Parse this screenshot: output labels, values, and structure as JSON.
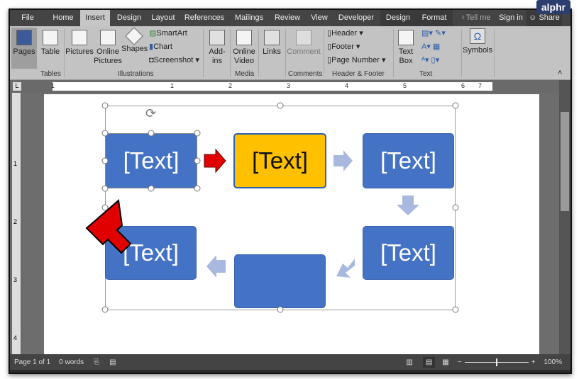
{
  "watermark": "alphr",
  "tabs": [
    "File",
    "Home",
    "Insert",
    "Design",
    "Layout",
    "References",
    "Mailings",
    "Review",
    "View",
    "Developer",
    "Design",
    "Format"
  ],
  "tell_me": "Tell me",
  "sign_in": "Sign in",
  "share": "Share",
  "ribbon": {
    "pages": "Pages",
    "table": "Table",
    "pictures": "Pictures",
    "online_pictures": "Online Pictures",
    "shapes": "Shapes",
    "smartart": "SmartArt",
    "chart": "Chart",
    "screenshot": "Screenshot",
    "addins": "Add-ins",
    "online_video": "Online Video",
    "links": "Links",
    "comment": "Comment",
    "header": "Header",
    "footer": "Footer",
    "page_number": "Page Number",
    "text_box": "Text Box",
    "symbols": "Symbols",
    "groups": {
      "tables": "Tables",
      "illustrations": "Illustrations",
      "media": "Media",
      "comments": "Comments",
      "header_footer": "Header & Footer",
      "text": "Text"
    }
  },
  "ruler": [
    "1",
    "1",
    "2",
    "3",
    "4",
    "5",
    "6",
    "7"
  ],
  "vruler": [
    "1",
    "2",
    "3",
    "4"
  ],
  "smartart": {
    "boxes": [
      "[Text]",
      "[Text]",
      "[Text]",
      "[Text]",
      "",
      "[Text]"
    ]
  },
  "status": {
    "page": "Page 1 of 1",
    "words": "0 words",
    "zoom": "100%"
  },
  "colors": {
    "box": "#4472c4",
    "selected": "#ffc000",
    "arrow": "#a9b8de",
    "pointer": "#e00000"
  }
}
